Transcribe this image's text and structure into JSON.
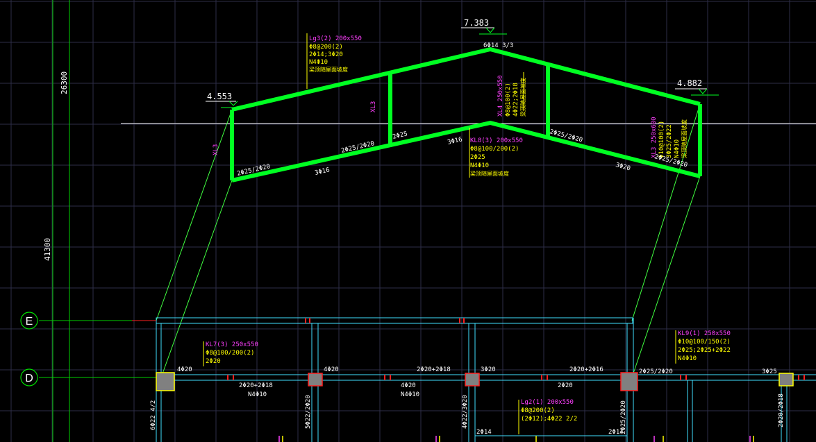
{
  "colors": {
    "background": "#000000",
    "grid": "#2e2e48",
    "axis_line": "#00e000",
    "beam_outline": "#00ff22",
    "leader": "#40ff40",
    "dim_line": "#ffffff",
    "label_magenta": "#ff40ff",
    "label_yellow": "#ffff00",
    "label_white": "#ffffff",
    "wall_cyan": "#40e0ff",
    "column_red": "#ff2020",
    "column_fill": "#808080"
  },
  "elevations": {
    "left": "4.553",
    "top": "7.383",
    "right": "4.882"
  },
  "dimensions": {
    "d1": "26300",
    "d2": "41300"
  },
  "grid_axes": {
    "e": "E",
    "d": "D"
  },
  "roof_labels": {
    "lg3_name": "Lg3(2) 200x550",
    "lg3_stirrup": "Φ8@200(2)",
    "lg3_bars": "2Φ14;3Φ20",
    "lg3_waist": "N4Φ10",
    "lg3_note": "梁顶随屋面坡度",
    "ridge_top": "6Φ14 3/3",
    "kl8_name": "KL8(3) 200x550",
    "kl8_stirrup": "Φ8@100/200(2)",
    "kl8_bars": "2Φ25",
    "kl8_waist": "N4Φ10",
    "kl8_note": "梁顶随屋面坡度",
    "xl4_name": "XL4 250x550",
    "xl4_stirrup": "Φ8@100(2)",
    "xl4_bars": "4Φ22;2Φ18",
    "xl4_note": "梁顶随屋面坡度",
    "xl3_name": "XL3 250x600",
    "xl3_stirrup": "Φ10@100(2)",
    "xl3_bars": "3Φ25/2Φ22",
    "xl3_waist": "N4Φ10",
    "xl3_note": "梁顶随屋面坡度",
    "tag_xl3_left": "XL3",
    "tag_xl3_mid": "XL3",
    "bar_a": "2Φ25/2Φ20",
    "bar_b": "3Φ16",
    "bar_c": "2Φ25/2Φ20",
    "bar_d": "2Φ25",
    "bar_e": "3Φ16",
    "bar_f": "2Φ25/2Φ20",
    "bar_g": "3Φ20",
    "bar_h": "2Φ25/2Φ20"
  },
  "plan_labels": {
    "kl7_name": "KL7(3) 250x550",
    "kl7_stirrup": "Φ8@100/200(2)",
    "kl7_bars": "2Φ20",
    "kl9_name": "KL9(1) 250x550",
    "kl9_stirrup": "Φ10@100/150(2)",
    "kl9_bars": "2Φ25;2Φ25+2Φ22",
    "kl9_waist": "N4Φ10",
    "lg2_name": "Lg2(1) 200x550",
    "lg2_stirrup": "Φ8@200(2)",
    "lg2_bars": "(2Φ12);4Φ22 2/2",
    "d_4b20_1": "4Φ20",
    "d_4b20_2": "4Φ20",
    "d_2b20_2b18": "2Φ20+2Φ18",
    "d_3b20": "3Φ20",
    "d_2b20_2b16": "2Φ20+2Φ16",
    "d_2b25_2b20": "2Φ25/2Φ20",
    "d_3b25": "3Φ25",
    "d_2b20_2b18_low": "2Φ20+2Φ18",
    "d_n4b10_1": "N4Φ10",
    "d_4b20_low": "4Φ20",
    "d_n4b10_2": "N4Φ10",
    "d_2b20_low": "2Φ20",
    "d_2b14_1": "2Φ14",
    "d_2b14_2": "2Φ14",
    "v_6b22": "6Φ22 4/2",
    "v_5b22": "5Φ22/2Φ20",
    "v_4b22": "4Φ22/3Φ20",
    "v_2b25": "2Φ25/2Φ20",
    "v_2b20": "2Φ20/2Φ18"
  }
}
